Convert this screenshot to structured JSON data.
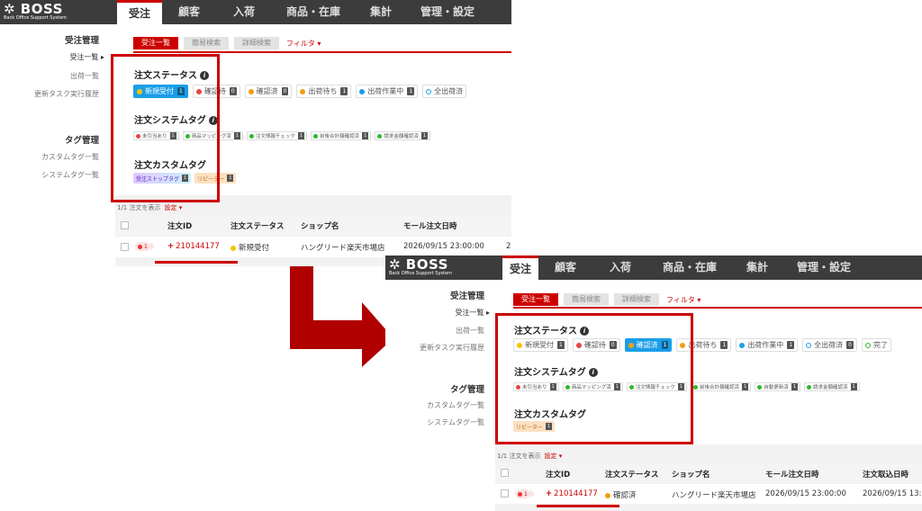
{
  "colors": {
    "accent": "#cc0000",
    "selected": "#1a9ee8",
    "nav_bg": "#3c3c3c"
  },
  "logo": {
    "mark": "BOSS",
    "subtitle": "Back Office Support System"
  },
  "nav": {
    "tabs": [
      "受注",
      "顧客",
      "入荷",
      "商品・在庫",
      "集計",
      "管理・設定"
    ]
  },
  "sidebar": {
    "order_head": "受注管理",
    "order_list": "受注一覧",
    "order_list_arrow": "▸",
    "shipping_list": "出荷一覧",
    "update_history": "更新タスク実行履歴",
    "tag_head": "タグ管理",
    "custom_tags": "カスタムタグ一覧",
    "system_tags": "システムタグ一覧"
  },
  "subtabs": {
    "list": "受注一覧",
    "simple": "簡易検索",
    "detail": "詳細検索",
    "filter": "フィルタ ▾"
  },
  "filters": {
    "status_title": "注文ステータス",
    "system_tag_title": "注文システムタグ",
    "custom_tag_title": "注文カスタムタグ",
    "info_icon": "i"
  },
  "statuses": [
    {
      "label": "新規受付",
      "count": "1",
      "color": "#f5c400"
    },
    {
      "label": "確認待",
      "count": "0",
      "color": "#e64545"
    },
    {
      "label": "確認済",
      "count": "0",
      "color": "#f39c12"
    },
    {
      "label": "出荷待ち",
      "count": "1",
      "color": "#f39c12"
    },
    {
      "label": "出荷作業中",
      "count": "1",
      "color": "#1a9ee8"
    },
    {
      "label": "全出荷済",
      "count": "0",
      "color": "#1a9ee8"
    },
    {
      "label": "完了",
      "count": "0",
      "color": "#2eb82e"
    }
  ],
  "system_tags_before": [
    {
      "label": "未引当あり",
      "count": "1",
      "color": "#e64545"
    },
    {
      "label": "商品マッピング済",
      "count": "1",
      "color": "#2eb82e"
    },
    {
      "label": "注文情報チェック",
      "count": "1",
      "color": "#2eb82e"
    },
    {
      "label": "前後合計額確認済",
      "count": "1",
      "color": "#2eb82e"
    },
    {
      "label": "請求金額確認済",
      "count": "1",
      "color": "#2eb82e"
    }
  ],
  "system_tags_after": [
    {
      "label": "未引当あり",
      "count": "1",
      "color": "#e64545"
    },
    {
      "label": "商品マッピング済",
      "count": "1",
      "color": "#2eb82e"
    },
    {
      "label": "注文情報チェック",
      "count": "1",
      "color": "#2eb82e"
    },
    {
      "label": "前後合計額確認済",
      "count": "1",
      "color": "#2eb82e"
    },
    {
      "label": "自動更新済",
      "count": "1",
      "color": "#2eb82e"
    },
    {
      "label": "請求金額確認済",
      "count": "1",
      "color": "#2eb82e"
    }
  ],
  "custom_tags": {
    "stop": {
      "label": "受注ストップタグ",
      "count": "1"
    },
    "repeat": {
      "label": "リピーター",
      "count": "1"
    }
  },
  "list_info": {
    "count": "1/1 注文を表示",
    "settings": "設定 ▾"
  },
  "table": {
    "headers": {
      "id": "注文ID",
      "status": "注文ステータス",
      "shop": "ショップ名",
      "mall_date": "モール注文日時",
      "import_date": "注文取込日時"
    },
    "badge": "1",
    "plus": "+",
    "before": {
      "order_id": "210144177",
      "status": "新規受付",
      "shop": "ハングリード楽天市場店",
      "mall_date": "2026/09/15 23:00:00",
      "extra": "2"
    },
    "after": {
      "order_id": "210144177",
      "status": "確認済",
      "shop": "ハングリード楽天市場店",
      "mall_date": "2026/09/15 23:00:00",
      "import_date": "2026/09/15 13:"
    }
  }
}
